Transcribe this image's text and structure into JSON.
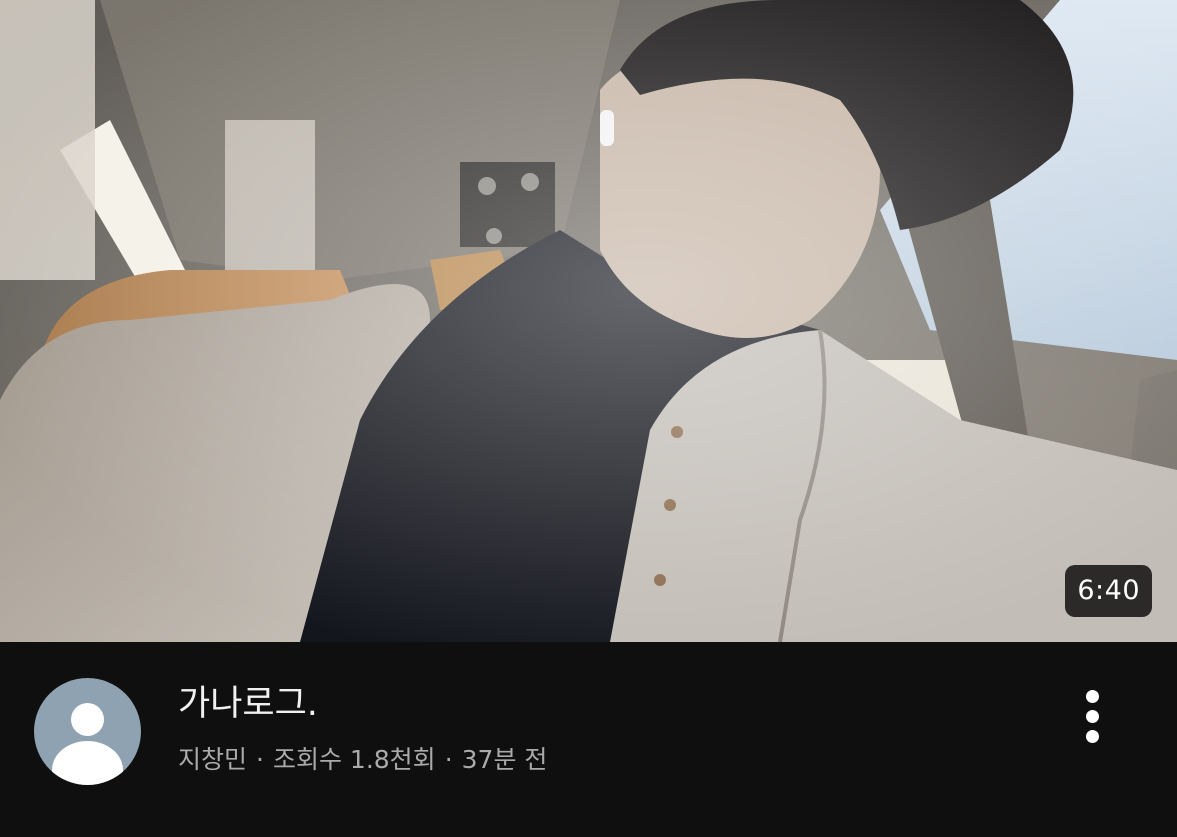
{
  "video": {
    "duration": "6:40",
    "title": "가나로그.",
    "channel": "지창민",
    "views": "조회수 1.8천회",
    "published": "37분 전",
    "separator": "·"
  },
  "icons": {
    "avatar": "default-avatar-icon",
    "more": "more-vert-icon"
  },
  "colors": {
    "background": "#0f0f0f",
    "title": "#f1f1f1",
    "subtext": "#aaaaaa",
    "avatar_bg": "#8ea2b1"
  }
}
